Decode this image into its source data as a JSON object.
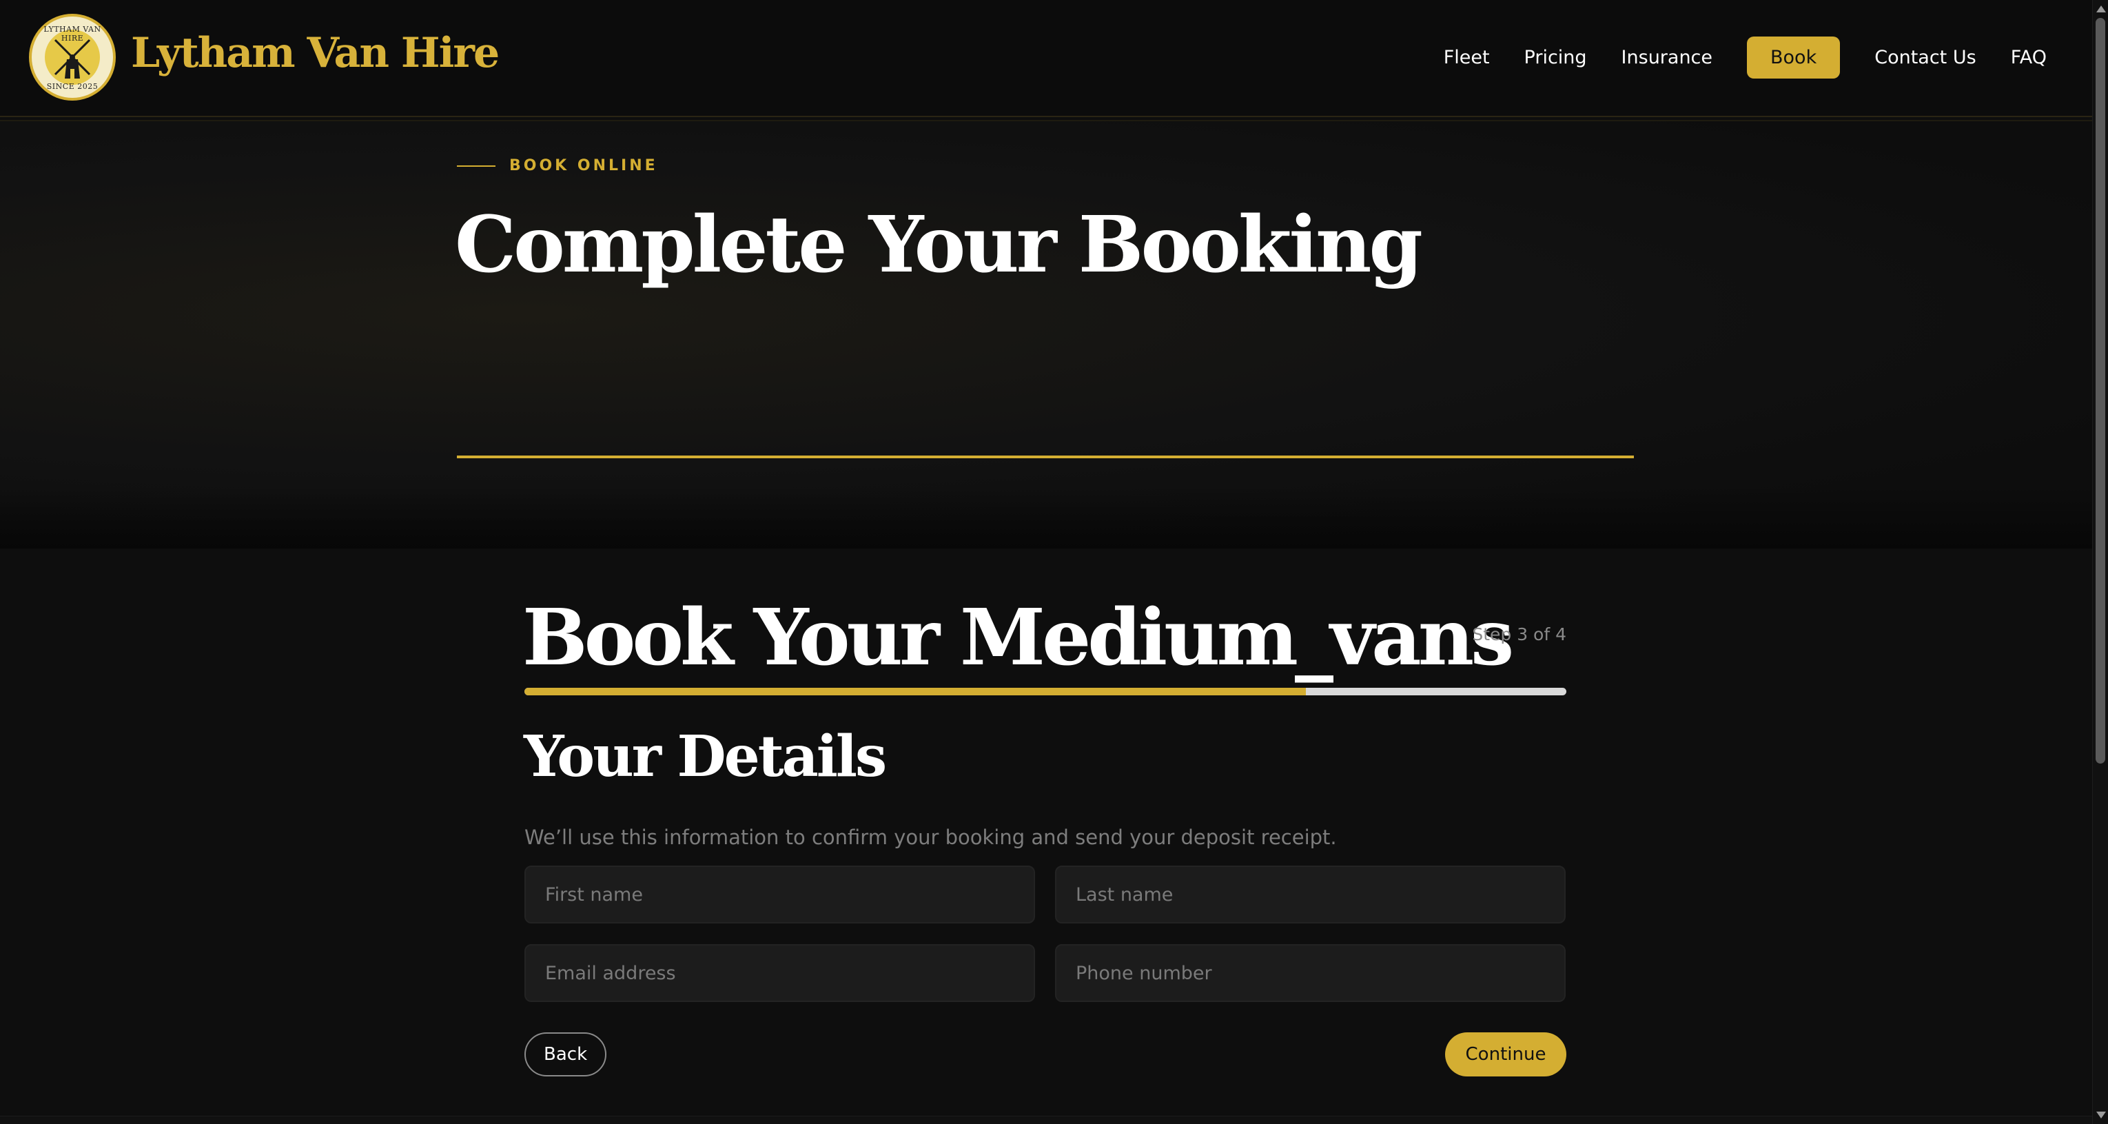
{
  "brand": {
    "name": "Lytham Van Hire",
    "seal_top_text": "LYTHAM VAN HIRE",
    "seal_bottom_text": "SINCE 2025"
  },
  "nav": {
    "items": [
      "Fleet",
      "Pricing",
      "Insurance",
      "Book",
      "Contact Us",
      "FAQ"
    ],
    "active": "Book"
  },
  "hero": {
    "eyebrow": "BOOK ONLINE",
    "title": "Complete Your Booking"
  },
  "booking": {
    "title": "Book Your Medium_vans",
    "step_label": "Step 3 of 4",
    "progress_fraction": 0.75,
    "section_title": "Your Details",
    "section_description": "We’ll use this information to confirm your booking and send your deposit receipt.",
    "fields": {
      "first_name_placeholder": "First name",
      "last_name_placeholder": "Last name",
      "email_placeholder": "Email address",
      "phone_placeholder": "Phone number"
    },
    "back_label": "Back",
    "continue_label": "Continue"
  },
  "colors": {
    "accent": "#d4ae32",
    "background": "#0e0e0e",
    "field_bg": "#1c1c1c"
  }
}
